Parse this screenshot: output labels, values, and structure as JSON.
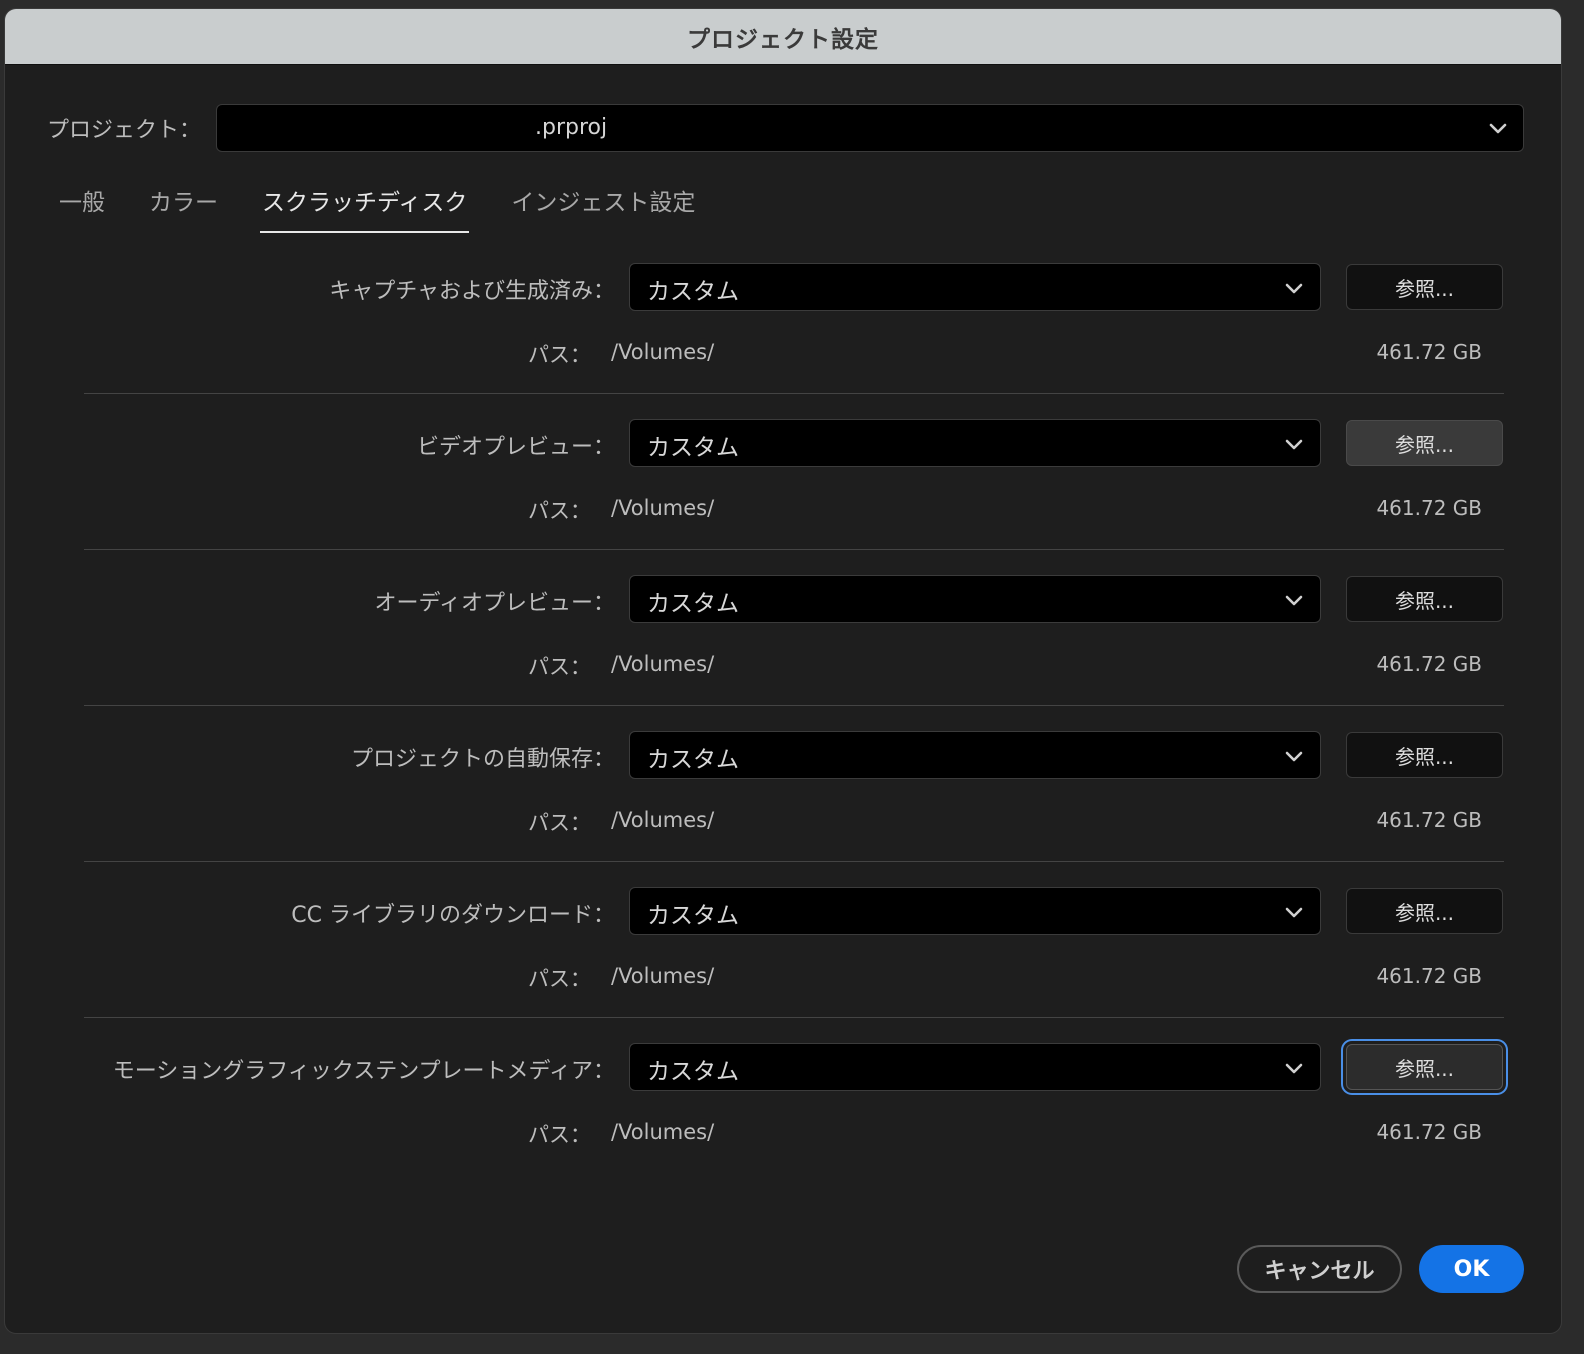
{
  "dialog": {
    "title": "プロジェクト設定",
    "project_label": "プロジェクト：",
    "project_value": ".prproj"
  },
  "tabs": [
    {
      "label": "一般",
      "active": false
    },
    {
      "label": "カラー",
      "active": false
    },
    {
      "label": "スクラッチディスク",
      "active": true
    },
    {
      "label": "インジェスト設定",
      "active": false
    }
  ],
  "sections": [
    {
      "label": "キャプチャおよび生成済み：",
      "select_value": "カスタム",
      "browse_label": "参照...",
      "path_label": "パス：",
      "path_value": "/Volumes/",
      "free_space": "461.72 GB"
    },
    {
      "label": "ビデオプレビュー：",
      "select_value": "カスタム",
      "browse_label": "参照...",
      "path_label": "パス：",
      "path_value": "/Volumes/",
      "free_space": "461.72 GB"
    },
    {
      "label": "オーディオプレビュー：",
      "select_value": "カスタム",
      "browse_label": "参照...",
      "path_label": "パス：",
      "path_value": "/Volumes/",
      "free_space": "461.72 GB"
    },
    {
      "label": "プロジェクトの自動保存：",
      "select_value": "カスタム",
      "browse_label": "参照...",
      "path_label": "パス：",
      "path_value": "/Volumes/",
      "free_space": "461.72 GB"
    },
    {
      "label": "CC ライブラリのダウンロード：",
      "select_value": "カスタム",
      "browse_label": "参照...",
      "path_label": "パス：",
      "path_value": "/Volumes/",
      "free_space": "461.72 GB"
    },
    {
      "label": "モーショングラフィックステンプレートメディア：",
      "select_value": "カスタム",
      "browse_label": "参照...",
      "path_label": "パス：",
      "path_value": "/Volumes/",
      "free_space": "461.72 GB"
    }
  ],
  "footer": {
    "cancel_label": "キャンセル",
    "ok_label": "OK"
  },
  "colors": {
    "accent": "#1473e6",
    "focus_ring": "#4a8fe7",
    "titlebar": "#c9cdce",
    "background": "#1e1e1e"
  }
}
